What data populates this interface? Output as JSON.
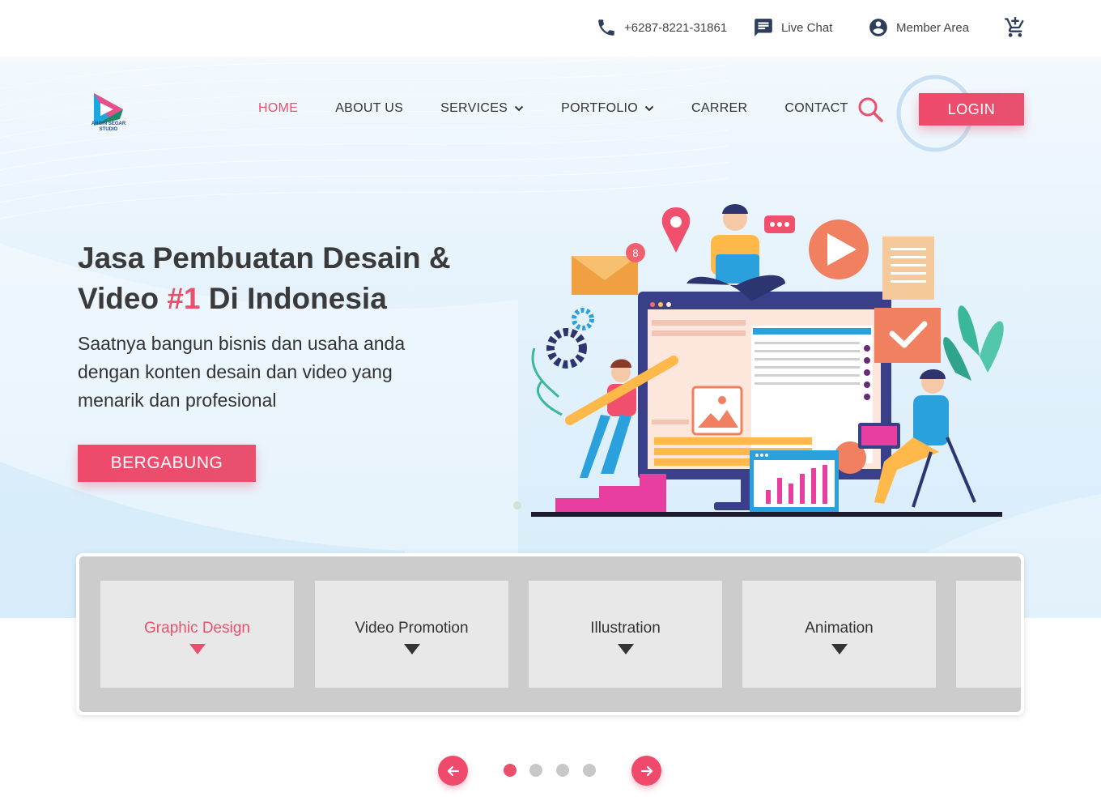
{
  "topbar": {
    "phone": "+6287-8221-31861",
    "live_chat": "Live Chat",
    "member_area": "Member Area",
    "icons": [
      "phone-icon",
      "chat-icon",
      "account-icon",
      "cart-icon"
    ]
  },
  "brand": {
    "logo_text_line1": "ANGIN SEGAR",
    "logo_text_line2": "STUDIO"
  },
  "nav": {
    "items": [
      {
        "label": "HOME",
        "active": true
      },
      {
        "label": "ABOUT US"
      },
      {
        "label": "SERVICES",
        "dropdown": true
      },
      {
        "label": "PORTFOLIO",
        "dropdown": true
      },
      {
        "label": "CARRER"
      },
      {
        "label": "CONTACT"
      }
    ],
    "login": "LOGIN"
  },
  "hero": {
    "headline_part1": "Jasa Pembuatan Desain &",
    "headline_part2a": "Video ",
    "headline_accent": "#1",
    "headline_part2b": " Di Indonesia",
    "subtext": "Saatnya bangun bisnis dan usaha anda dengan konten desain dan video yang menarik dan profesional",
    "cta": "BERGABUNG",
    "notification_count": "8"
  },
  "categories": [
    {
      "label": "Graphic Design",
      "active": true
    },
    {
      "label": "Video Promotion"
    },
    {
      "label": "Illustration"
    },
    {
      "label": "Animation"
    }
  ],
  "pagination": {
    "pages": 4,
    "current": 1
  },
  "colors": {
    "accent": "#e8506e",
    "text": "#333333",
    "hero_bg": "#e4f2fc",
    "panel": "#cccccc",
    "card": "#e8e8e8"
  }
}
